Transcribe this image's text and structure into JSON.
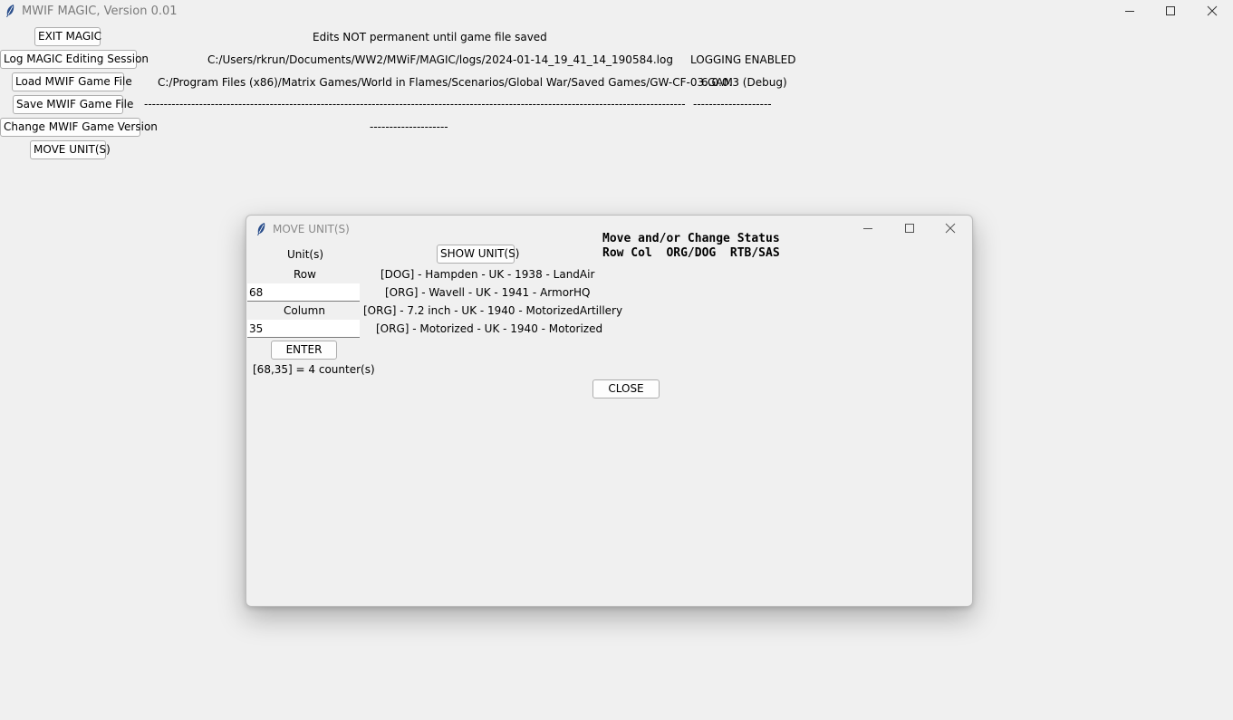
{
  "main_window": {
    "title": "MWIF MAGIC, Version 0.01",
    "buttons": {
      "exit": "EXIT MAGIC",
      "log_session": "Log MAGIC Editing Session",
      "load_game": "Load MWIF Game File",
      "save_game": "Save MWIF Game File",
      "change_version": "Change MWIF Game Version",
      "move_units": "MOVE UNIT(S)"
    },
    "notice": "Edits NOT permanent until game file saved",
    "log_path": "C:/Users/rkrun/Documents/WW2/MWiF/MAGIC/logs/2024-01-14_19_41_14_190584.log",
    "logging_status": "LOGGING ENABLED",
    "game_file_path": "C:/Program Files (x86)/Matrix Games/World in Flames/Scenarios/Global War/Saved Games/GW-CF-03.GAM",
    "game_version": "6.0.0.3 (Debug)",
    "save_separator": "-------------------------------------------------------------------------------------------------------------------------------------------------------------",
    "save_status_separator": "--------------------",
    "version_separator": "--------------------"
  },
  "dialog": {
    "title": "MOVE UNIT(S)",
    "units_label": "Unit(s)",
    "show_units_button": "SHOW UNIT(S)",
    "heading_line1": "Move and/or Change Status",
    "heading_line2": "Row Col  ORG/DOG  RTB/SAS",
    "row_label": "Row",
    "row_value": "68",
    "column_label": "Column",
    "column_value": "35",
    "enter_button": "ENTER",
    "counter_summary": "[68,35] = 4 counter(s)",
    "close_button": "CLOSE",
    "units": [
      "[DOG] - Hampden - UK - 1938 - LandAir",
      "[ORG] - Wavell - UK - 1941 - ArmorHQ",
      "[ORG] - 7.2 inch - UK - 1940 - MotorizedArtillery",
      "[ORG] - Motorized - UK - 1940 - Motorized"
    ]
  },
  "icons": {
    "app_icon": "feather-icon",
    "minimize": "minimize-icon",
    "maximize": "maximize-icon",
    "close": "close-icon"
  }
}
